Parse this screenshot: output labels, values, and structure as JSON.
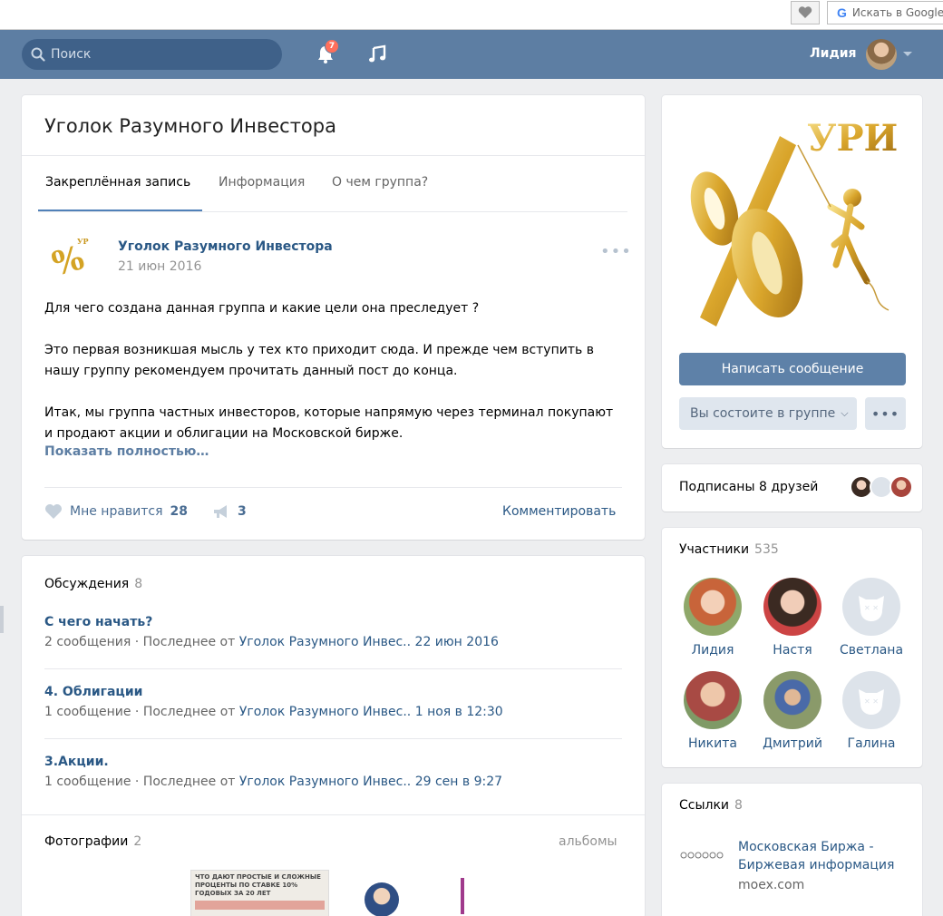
{
  "browser": {
    "search_placeholder": "Искать в Google"
  },
  "header": {
    "search_placeholder": "Поиск",
    "notifications_count": "7",
    "user_name": "Лидия"
  },
  "group": {
    "title": "Уголок Разумного Инвестора",
    "tabs": [
      {
        "label": "Закреплённая запись"
      },
      {
        "label": "Информация"
      },
      {
        "label": "О чем группа?"
      }
    ]
  },
  "post": {
    "author": "Уголок Разумного Инвестора",
    "date": "21 июн 2016",
    "paragraphs": [
      "Для чего создана данная группа и какие цели она преследует ?",
      "Это первая возникшая мысль у тех кто приходит сюда. И прежде чем вступить в нашу группу рекомендуем прочитать данный пост до конца.",
      "Итак, мы группа частных инвесторов, которые напрямую через терминал покупают и продают акции и облигации на Московской бирже."
    ],
    "show_more": "Показать полностью…",
    "like_label": "Мне нравится",
    "like_count": "28",
    "share_count": "3",
    "comment_label": "Комментировать"
  },
  "discussions": {
    "title": "Обсуждения",
    "count": "8",
    "items": [
      {
        "title": "С чего начать?",
        "messages": "2 сообщения",
        "last_from": "Последнее от",
        "author": "Уголок Разумного Инвес..",
        "time": "22 июн 2016"
      },
      {
        "title": "4. Облигации",
        "messages": "1 сообщение",
        "last_from": "Последнее от",
        "author": "Уголок Разумного Инвес..",
        "time": "1 ноя в 12:30"
      },
      {
        "title": "3.Акции.",
        "messages": "1 сообщение",
        "last_from": "Последнее от",
        "author": "Уголок Разумного Инвес..",
        "time": "29 сен в 9:27"
      }
    ]
  },
  "photos": {
    "title": "Фотографии",
    "count": "2",
    "albums_label": "альбомы",
    "preview_caption": "ЧТО ДАЮТ ПРОСТЫЕ И СЛОЖНЫЕ ПРОЦЕНТЫ ПО СТАВКЕ 10% ГОДОВЫХ ЗА 20 ЛЕТ"
  },
  "cover": {
    "logo_text": "УРИ",
    "write_message": "Написать сообщение",
    "member_status": "Вы состоите в группе"
  },
  "friends": {
    "text": "Подписаны 8 друзей"
  },
  "members": {
    "title": "Участники",
    "count": "535",
    "items": [
      {
        "name": "Лидия"
      },
      {
        "name": "Настя"
      },
      {
        "name": "Светлана"
      },
      {
        "name": "Никита"
      },
      {
        "name": "Дмитрий"
      },
      {
        "name": "Галина"
      }
    ]
  },
  "links": {
    "title": "Ссылки",
    "count": "8",
    "items": [
      {
        "title": "Московская Биржа - Биржевая информация",
        "domain": "moex.com"
      }
    ]
  },
  "colors": {
    "header_bg": "#5d7ea3",
    "accent": "#5181b8",
    "link": "#2a5885",
    "badge": "#ff6f5b"
  }
}
